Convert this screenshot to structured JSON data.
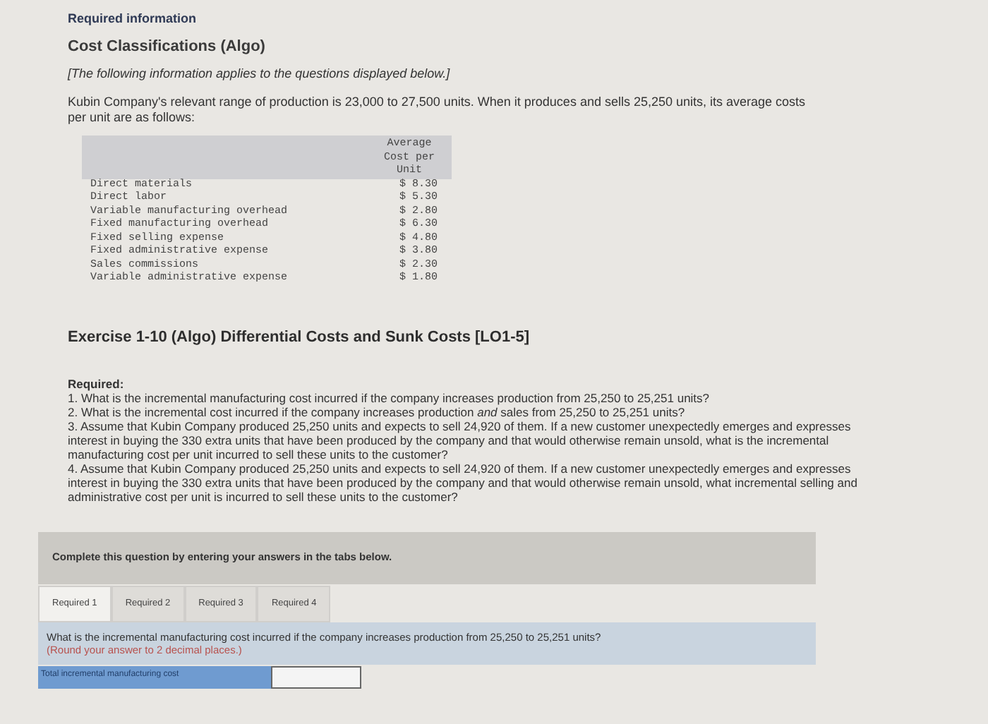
{
  "header": {
    "section": "Required information",
    "title": "Cost Classifications (Algo)",
    "note": "[The following information applies to the questions displayed below.]",
    "intro": "Kubin Company's relevant range of production is 23,000 to 27,500 units. When it produces and sells 25,250 units, its average costs per unit are as follows:"
  },
  "cost_table": {
    "column_heading": "Average Cost per Unit",
    "rows": [
      {
        "label": "Direct materials",
        "value": "$ 8.30"
      },
      {
        "label": "Direct labor",
        "value": "$ 5.30"
      },
      {
        "label": "Variable manufacturing overhead",
        "value": "$ 2.80"
      },
      {
        "label": "Fixed manufacturing overhead",
        "value": "$ 6.30"
      },
      {
        "label": "Fixed selling expense",
        "value": "$ 4.80"
      },
      {
        "label": "Fixed administrative expense",
        "value": "$ 3.80"
      },
      {
        "label": "Sales commissions",
        "value": "$ 2.30"
      },
      {
        "label": "Variable administrative expense",
        "value": "$ 1.80"
      }
    ]
  },
  "exercise_title": "Exercise 1-10 (Algo) Differential Costs and Sunk Costs [LO1-5]",
  "required_label": "Required:",
  "questions": [
    "1. What is the incremental manufacturing cost incurred if the company increases production from 25,250 to 25,251 units?",
    "2. What is the incremental cost incurred if the company increases production *and* sales from 25,250 to 25,251 units?",
    "3. Assume that Kubin Company produced 25,250 units and expects to sell 24,920 of them. If a new customer unexpectedly emerges and expresses interest in buying the 330 extra units that have been produced by the company and that would otherwise remain unsold, what is the incremental manufacturing cost per unit incurred to sell these units to the customer?",
    "4. Assume that Kubin Company produced 25,250 units and expects to sell 24,920 of them. If a new customer unexpectedly emerges and expresses interest in buying the 330 extra units that have been produced by the company and that would otherwise remain unsold, what incremental selling and administrative cost per unit is incurred to sell these units to the customer?"
  ],
  "instruction": "Complete this question by entering your answers in the tabs below.",
  "tabs": [
    {
      "label": "Required 1",
      "selected": true
    },
    {
      "label": "Required 2",
      "selected": false
    },
    {
      "label": "Required 3",
      "selected": false
    },
    {
      "label": "Required 4",
      "selected": false
    }
  ],
  "prompt": {
    "question": "What is the incremental manufacturing cost incurred if the company increases production from 25,250 to 25,251 units?",
    "hint": "(Round your answer to 2 decimal places.)"
  },
  "answer": {
    "label": "Total incremental manufacturing cost"
  }
}
